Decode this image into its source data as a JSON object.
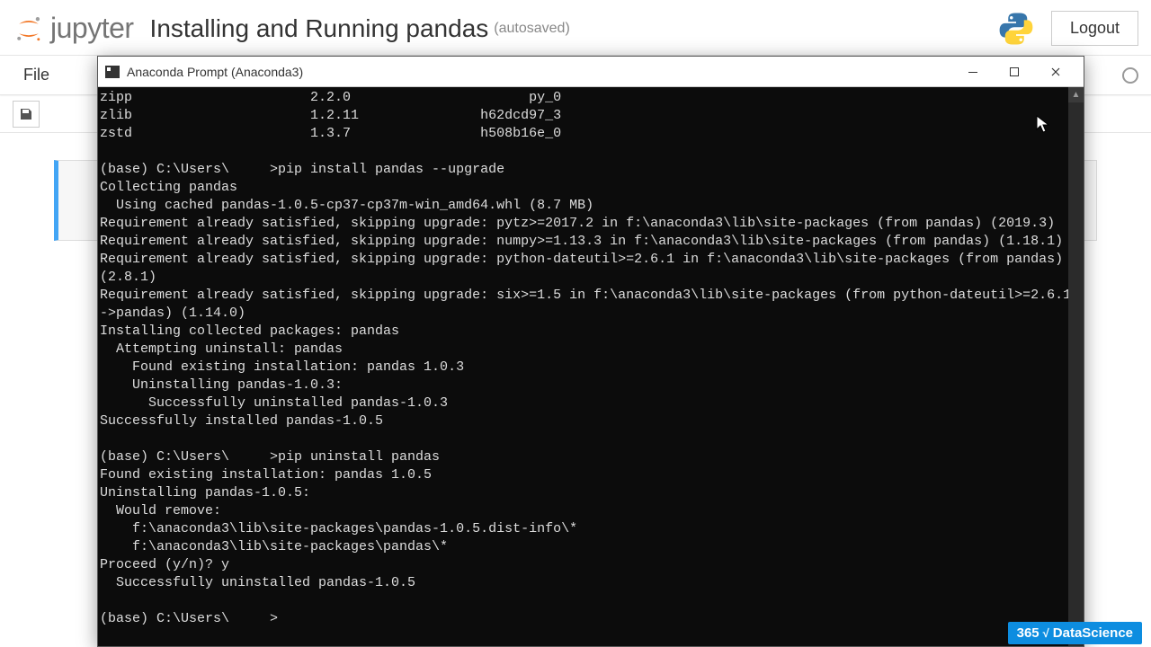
{
  "header": {
    "logo_text": "jupyter",
    "title": "Installing and Running pandas",
    "autosave": "(autosaved)",
    "logout": "Logout"
  },
  "menubar": {
    "file": "File"
  },
  "cmd": {
    "title": "Anaconda Prompt (Anaconda3)",
    "minimize": "—",
    "maximize": "☐",
    "close": "✕",
    "lines": [
      "zipp                      2.2.0                      py_0",
      "zlib                      1.2.11               h62dcd97_3",
      "zstd                      1.3.7                h508b16e_0",
      "",
      "(base) C:\\Users\\     >pip install pandas --upgrade",
      "Collecting pandas",
      "  Using cached pandas-1.0.5-cp37-cp37m-win_amd64.whl (8.7 MB)",
      "Requirement already satisfied, skipping upgrade: pytz>=2017.2 in f:\\anaconda3\\lib\\site-packages (from pandas) (2019.3)",
      "Requirement already satisfied, skipping upgrade: numpy>=1.13.3 in f:\\anaconda3\\lib\\site-packages (from pandas) (1.18.1)",
      "Requirement already satisfied, skipping upgrade: python-dateutil>=2.6.1 in f:\\anaconda3\\lib\\site-packages (from pandas)",
      "(2.8.1)",
      "Requirement already satisfied, skipping upgrade: six>=1.5 in f:\\anaconda3\\lib\\site-packages (from python-dateutil>=2.6.1",
      "->pandas) (1.14.0)",
      "Installing collected packages: pandas",
      "  Attempting uninstall: pandas",
      "    Found existing installation: pandas 1.0.3",
      "    Uninstalling pandas-1.0.3:",
      "      Successfully uninstalled pandas-1.0.3",
      "Successfully installed pandas-1.0.5",
      "",
      "(base) C:\\Users\\     >pip uninstall pandas",
      "Found existing installation: pandas 1.0.5",
      "Uninstalling pandas-1.0.5:",
      "  Would remove:",
      "    f:\\anaconda3\\lib\\site-packages\\pandas-1.0.5.dist-info\\*",
      "    f:\\anaconda3\\lib\\site-packages\\pandas\\*",
      "Proceed (y/n)? y",
      "  Successfully uninstalled pandas-1.0.5",
      "",
      "(base) C:\\Users\\     >"
    ]
  },
  "badge": {
    "prefix": "365",
    "suffix": "DataScience"
  }
}
